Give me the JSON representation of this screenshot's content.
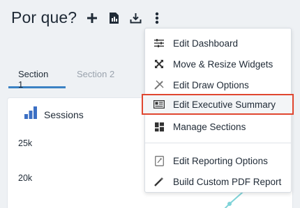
{
  "header": {
    "title": "Por que?"
  },
  "tabs": [
    {
      "label": "Section 1",
      "active": true
    },
    {
      "label": "Section 2",
      "active": false
    }
  ],
  "widget": {
    "title": "Sessions",
    "y_ticks": [
      "25k",
      "20k"
    ],
    "accent_color": "#3b6fc4",
    "line_color": "#7fd3d8"
  },
  "menu": {
    "items": [
      {
        "label": "Edit Dashboard",
        "icon": "sliders-icon"
      },
      {
        "label": "Move & Resize Widgets",
        "icon": "move-arrows-icon"
      },
      {
        "label": "Edit Draw Options",
        "icon": "draw-tools-icon"
      },
      {
        "label": "Edit Executive Summary",
        "icon": "summary-icon",
        "highlighted": true
      },
      {
        "label": "Manage Sections",
        "icon": "sections-icon"
      },
      {
        "label": "Edit Reporting Options",
        "icon": "report-options-icon"
      },
      {
        "label": "Build Custom PDF Report",
        "icon": "magic-wand-icon"
      }
    ],
    "highlight_color": "#e0462f"
  }
}
